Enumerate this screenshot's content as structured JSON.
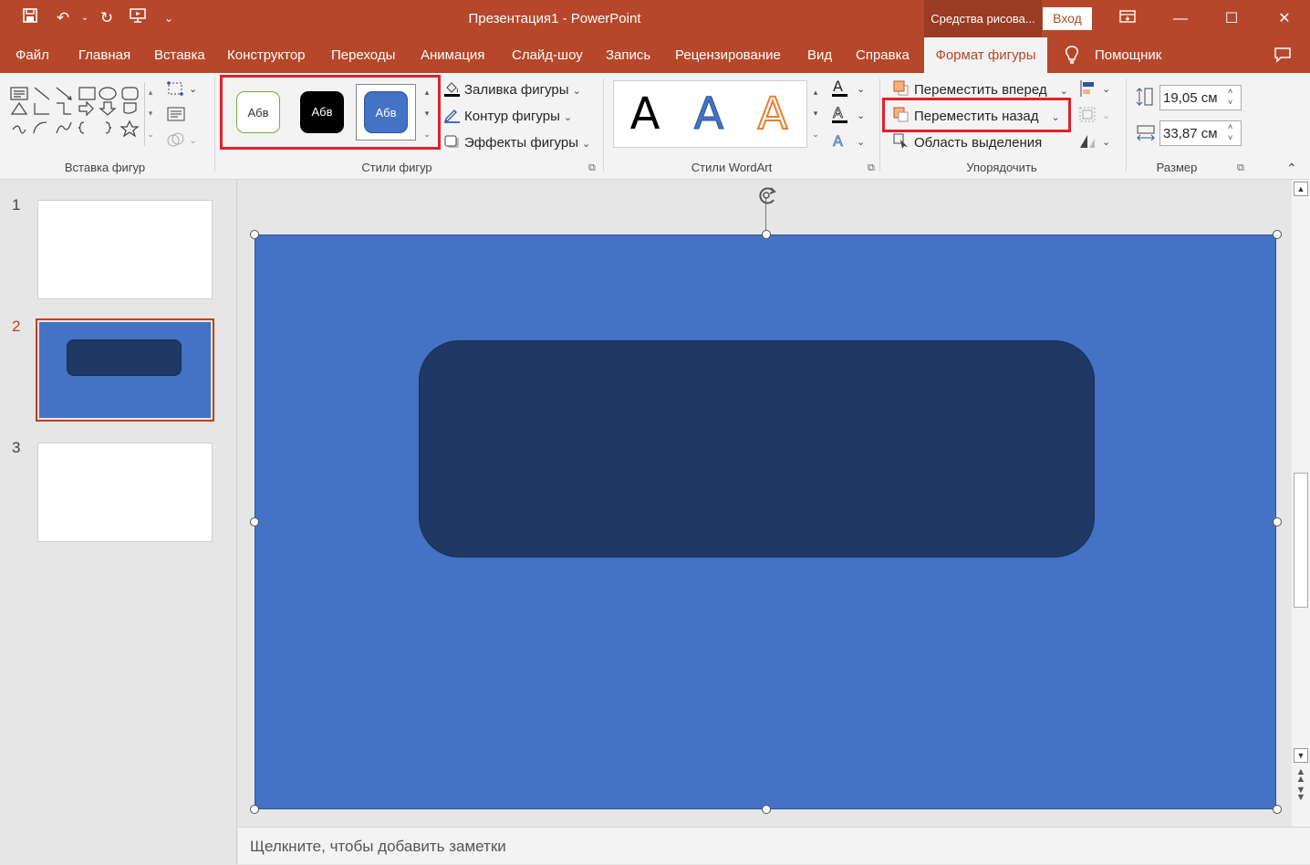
{
  "window": {
    "title": "Презентация1  -  PowerPoint",
    "drawing_tools": "Средства рисова...",
    "sign_in": "Вход"
  },
  "tabs": [
    {
      "label": "Файл"
    },
    {
      "label": "Главная"
    },
    {
      "label": "Вставка"
    },
    {
      "label": "Конструктор"
    },
    {
      "label": "Переходы"
    },
    {
      "label": "Анимация"
    },
    {
      "label": "Слайд-шоу"
    },
    {
      "label": "Запись"
    },
    {
      "label": "Рецензирование"
    },
    {
      "label": "Вид"
    },
    {
      "label": "Справка"
    },
    {
      "label": "Формат фигуры",
      "active": true
    },
    {
      "label": "Помощник"
    }
  ],
  "ribbon": {
    "insert_shapes": {
      "label": "Вставка фигур"
    },
    "shape_styles": {
      "label": "Стили фигур",
      "presets": [
        "Абв",
        "Абв",
        "Абв"
      ],
      "fill": "Заливка фигуры",
      "outline": "Контур фигуры",
      "effects": "Эффекты фигуры"
    },
    "wordart": {
      "label": "Стили WordArt",
      "samples": [
        "A",
        "A",
        "A"
      ]
    },
    "arrange": {
      "label": "Упорядочить",
      "bring_forward": "Переместить вперед",
      "send_backward": "Переместить назад",
      "selection_pane": "Область выделения"
    },
    "size": {
      "label": "Размер",
      "height": "19,05 см",
      "width": "33,87 см"
    }
  },
  "slides": [
    {
      "number": "1"
    },
    {
      "number": "2",
      "selected": true
    },
    {
      "number": "3"
    }
  ],
  "notes_placeholder": "Щелкните, чтобы добавить заметки",
  "colors": {
    "accent": "#b7472a",
    "slide_background": "#4472c4",
    "inner_shape": "#203864",
    "highlight": "#e0202b"
  }
}
